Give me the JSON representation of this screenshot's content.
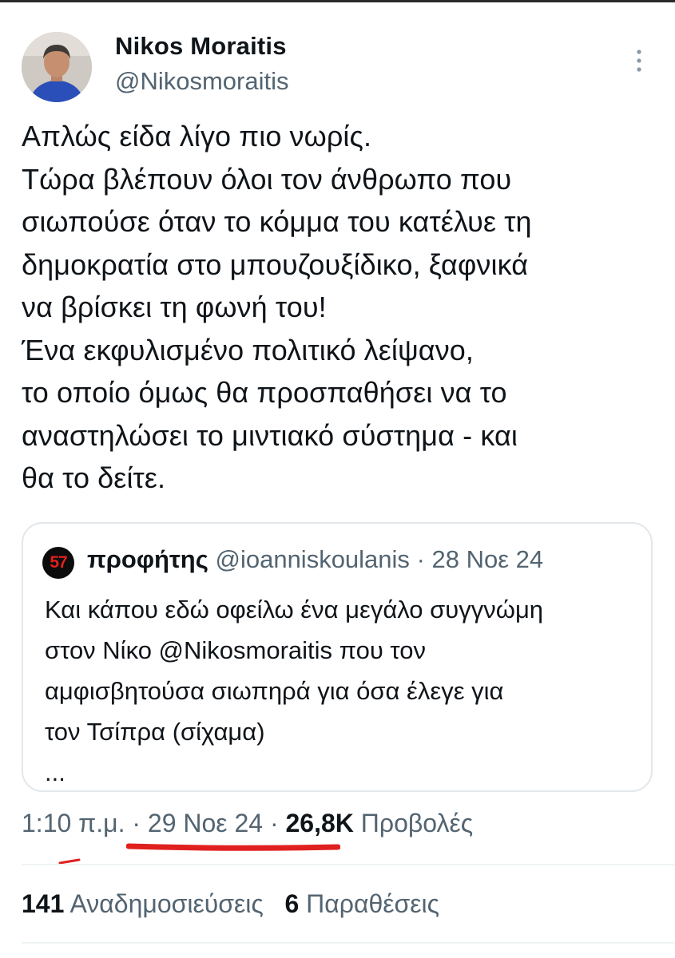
{
  "author": {
    "display_name": "Nikos Moraitis",
    "handle": "@Nikosmoraitis"
  },
  "post": {
    "lines": [
      "Απλώς είδα λίγο πιο νωρίς.",
      "Τώρα βλέπουν όλοι τον άνθρωπο που",
      "σιωπούσε όταν το κόμμα του κατέλυε τη",
      "δημοκρατία στο μπουζουξίδικο, ξαφνικά",
      "να βρίσκει τη φωνή του!",
      "Ένα εκφυλισμένο πολιτικό λείψανο,",
      "το οποίο όμως θα προσπαθήσει να το",
      "αναστηλώσει το μιντιακό σύστημα - και",
      "θα το δείτε."
    ]
  },
  "quote": {
    "avatar_text": "57",
    "name": "προφήτης",
    "handle": "@ioanniskoulanis",
    "separator": " · ",
    "date": "28 Νοε 24",
    "lines": [
      "Και κάπου εδώ οφείλω ένα μεγάλο συγγνώμη",
      "στον Νίκο @Nikosmoraitis που τον",
      "αμφισβητούσα σιωπηρά για όσα έλεγε για",
      "τον Τσίπρα (σίχαμα)",
      "..."
    ]
  },
  "meta": {
    "time": "1:10 π.μ.",
    "separator": " · ",
    "date": "29 Νοε 24",
    "views_count": "26,8K",
    "views_label": "Προβολές"
  },
  "stats": {
    "reposts_count": "141",
    "reposts_label": "Αναδημοσιεύσεις",
    "quotes_count": "6",
    "quotes_label": "Παραθέσεις"
  },
  "colors": {
    "text": "#0f1419",
    "muted": "#536471",
    "border": "#e3e7ea",
    "underline": "#e0201f"
  }
}
